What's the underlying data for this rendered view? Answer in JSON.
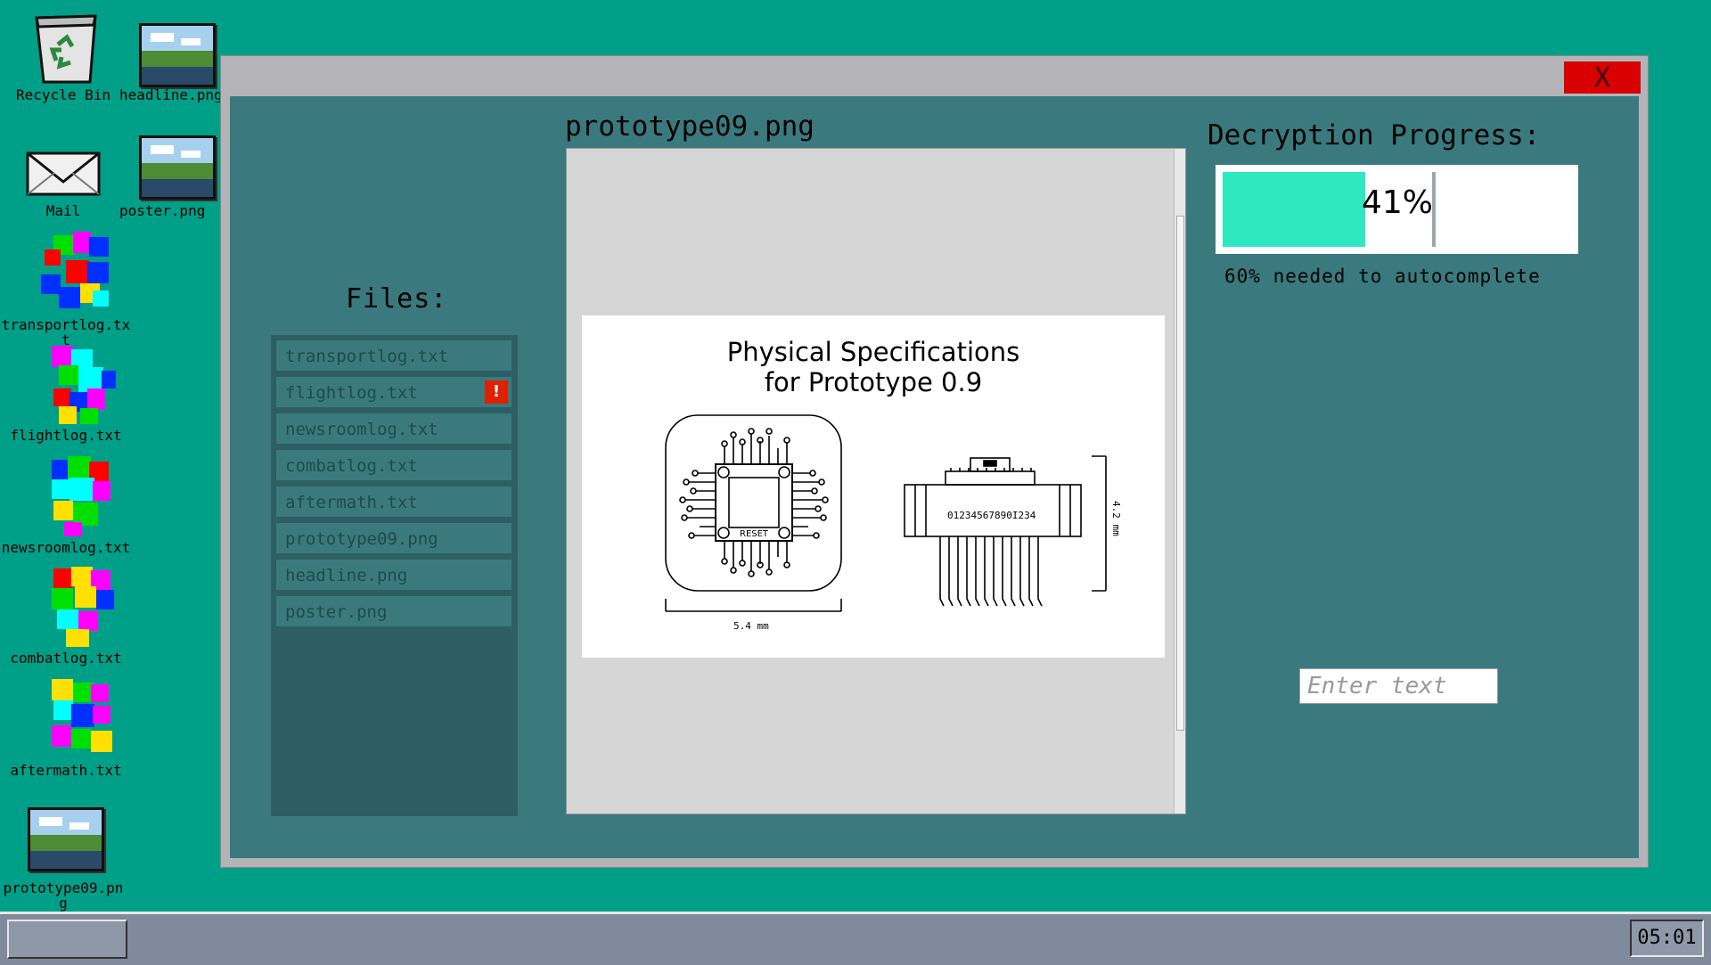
{
  "desktop": {
    "icons": [
      {
        "label": "Recycle Bin",
        "icon": "recycle-bin-icon"
      },
      {
        "label": "headline.png",
        "icon": "image-file-icon"
      },
      {
        "label": "Mail",
        "icon": "mail-icon"
      },
      {
        "label": "poster.png",
        "icon": "image-file-icon"
      },
      {
        "label": "transportlog.txt",
        "icon": "corrupted-file-icon"
      },
      {
        "label": "flightlog.txt",
        "icon": "corrupted-file-icon"
      },
      {
        "label": "newsroomlog.txt",
        "icon": "corrupted-file-icon"
      },
      {
        "label": "combatlog.txt",
        "icon": "corrupted-file-icon"
      },
      {
        "label": "aftermath.txt",
        "icon": "corrupted-file-icon"
      },
      {
        "label": "prototype09.png",
        "icon": "image-file-icon"
      }
    ]
  },
  "window": {
    "close_label": "X",
    "files_title": "Files:",
    "files": [
      {
        "name": "transportlog.txt"
      },
      {
        "name": "flightlog.txt",
        "alert": "!"
      },
      {
        "name": "newsroomlog.txt"
      },
      {
        "name": "combatlog.txt"
      },
      {
        "name": "aftermath.txt"
      },
      {
        "name": "prototype09.png"
      },
      {
        "name": "headline.png"
      },
      {
        "name": "poster.png"
      }
    ],
    "viewer_title": "prototype09.png",
    "document": {
      "title_line1": "Physical Specifications",
      "title_line2": "for Prototype 0.9",
      "chip_label": "RESET",
      "barcode_text": "01234567890I234",
      "width_dim": "5.4 mm",
      "height_dim": "4.2 mm"
    },
    "progress": {
      "title": "Decryption Progress:",
      "percent_text": "41%",
      "fraction": 0.41,
      "threshold_fraction": 0.6,
      "note": "60% needed to autocomplete"
    },
    "input": {
      "placeholder": "Enter text",
      "value": ""
    }
  },
  "taskbar": {
    "clock": "05:01"
  },
  "colors": {
    "desktop": "#009f87",
    "window_body": "#3a7a7e",
    "close_button": "#d80000",
    "progress_fill": "#2de8c0",
    "alert": "#e02000"
  }
}
